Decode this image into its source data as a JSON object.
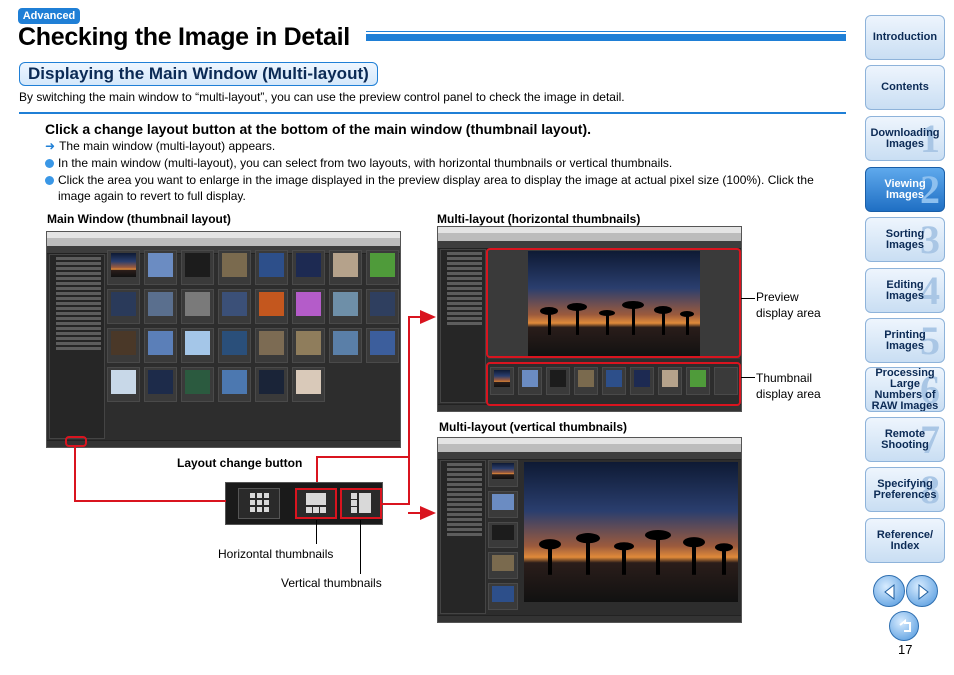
{
  "badge": "Advanced",
  "title": "Checking the Image in Detail",
  "section": "Displaying the Main Window (Multi-layout)",
  "intro": "By switching the main window to “multi-layout”, you can use the preview control panel to check the image in detail.",
  "step": "Click a change layout button at the bottom of the main window (thumbnail layout).",
  "bullets": {
    "b1": "The main window (multi-layout) appears.",
    "b2": "In the main window (multi-layout), you can select from two layouts, with horizontal thumbnails or vertical thumbnails.",
    "b3a": "Click the area you want to enlarge in the image displayed in the preview display area to display the image at actual pixel size (100%). Click the",
    "b3b": "image again to revert to full display."
  },
  "captions": {
    "main_window": "Main Window (thumbnail layout)",
    "multi_h": "Multi-layout (horizontal thumbnails)",
    "multi_v": "Multi-layout (vertical thumbnails)",
    "layout_button": "Layout change button"
  },
  "labels": {
    "preview_1": "Preview",
    "preview_2": "display area",
    "thumb_1": "Thumbnail",
    "thumb_2": "display area",
    "horizontal": "Horizontal thumbnails",
    "vertical": "Vertical thumbnails"
  },
  "nav": [
    {
      "label": "Introduction"
    },
    {
      "label": "Contents"
    },
    {
      "label": "Downloading Images",
      "num": "1"
    },
    {
      "label": "Viewing Images",
      "num": "2",
      "active": true
    },
    {
      "label": "Sorting Images",
      "num": "3"
    },
    {
      "label": "Editing Images",
      "num": "4"
    },
    {
      "label": "Printing Images",
      "num": "5"
    },
    {
      "label": "Processing Large Numbers of RAW Images",
      "num": "6"
    },
    {
      "label": "Remote Shooting",
      "num": "7"
    },
    {
      "label": "Specifying Preferences",
      "num": "8"
    },
    {
      "label": "Reference/ Index"
    }
  ],
  "page_number": "17",
  "colors": {
    "accent": "#1f7fd6",
    "callout": "#d9141f"
  },
  "icons": [
    "prev-page-icon",
    "next-page-icon",
    "return-icon",
    "grid-layout-icon",
    "horizontal-layout-icon",
    "vertical-layout-icon"
  ]
}
